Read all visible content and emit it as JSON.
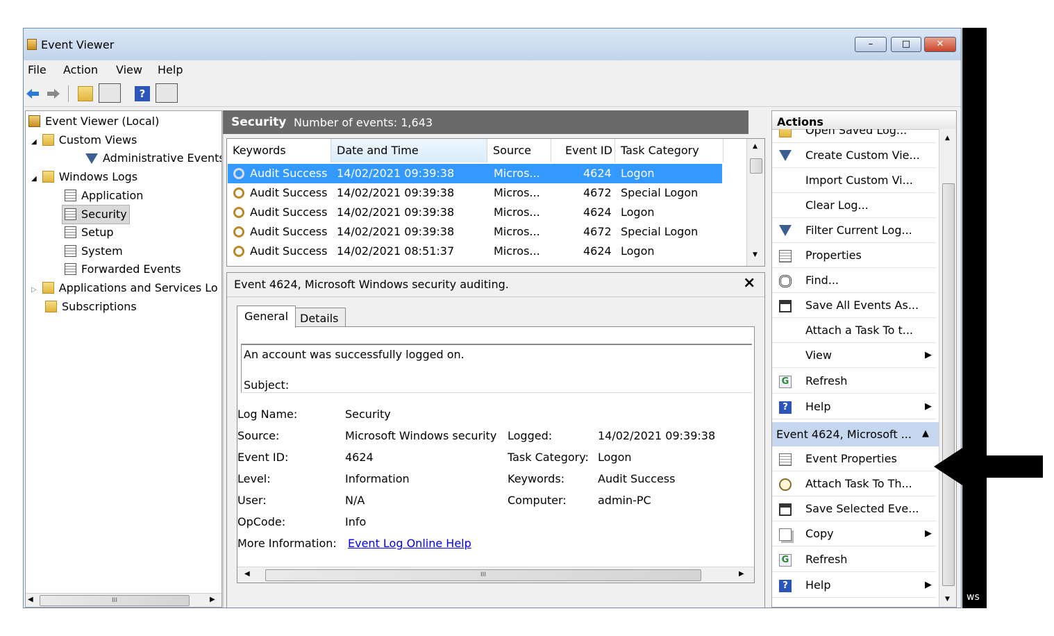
{
  "window": {
    "title": "Event Viewer",
    "min_label": "–",
    "max_label": "□",
    "close_label": "✕"
  },
  "menu": [
    "File",
    "Action",
    "View",
    "Help"
  ],
  "toolbar": {
    "icons": [
      "back-arrow-icon",
      "forward-arrow-icon",
      "folder-up-icon",
      "show-hide-tree-icon",
      "help-icon",
      "show-hide-action-pane-icon"
    ]
  },
  "tree": {
    "root": "Event Viewer (Local)",
    "custom_views": "Custom Views",
    "admin_events": "Administrative Events",
    "windows_logs": "Windows Logs",
    "application": "Application",
    "security": "Security",
    "setup": "Setup",
    "system": "System",
    "forwarded": "Forwarded Events",
    "apps_services": "Applications and Services Lo",
    "subscriptions": "Subscriptions",
    "hscroll_mark": "III"
  },
  "center": {
    "log_name": "Security",
    "event_count": "Number of events: 1,643"
  },
  "list": {
    "columns": [
      "Keywords",
      "Date and Time",
      "Source",
      "Event ID",
      "Task Category"
    ],
    "rows": [
      {
        "keywords": "Audit Success",
        "date": "14/02/2021 09:39:38",
        "source": "Micros...",
        "id": "4624",
        "task": "Logon"
      },
      {
        "keywords": "Audit Success",
        "date": "14/02/2021 09:39:38",
        "source": "Micros...",
        "id": "4672",
        "task": "Special Logon"
      },
      {
        "keywords": "Audit Success",
        "date": "14/02/2021 09:39:38",
        "source": "Micros...",
        "id": "4624",
        "task": "Logon"
      },
      {
        "keywords": "Audit Success",
        "date": "14/02/2021 09:39:38",
        "source": "Micros...",
        "id": "4672",
        "task": "Special Logon"
      },
      {
        "keywords": "Audit Success",
        "date": "14/02/2021 08:51:37",
        "source": "Micros...",
        "id": "4624",
        "task": "Logon"
      }
    ]
  },
  "detail": {
    "header": "Event 4624, Microsoft Windows security auditing.",
    "close": "×",
    "tab_general": "General",
    "tab_details": "Details",
    "message": "An account was successfully logged on.",
    "subject": "Subject:",
    "labels": {
      "log_name": "Log Name:",
      "source": "Source:",
      "event_id": "Event ID:",
      "level": "Level:",
      "user": "User:",
      "opcode": "OpCode:",
      "more_info": "More Information:",
      "logged": "Logged:",
      "task_category": "Task Category:",
      "keywords": "Keywords:",
      "computer": "Computer:"
    },
    "values": {
      "log_name": "Security",
      "source": "Microsoft Windows security",
      "event_id": "4624",
      "level": "Information",
      "user": "N/A",
      "opcode": "Info",
      "more_info": "Event Log Online Help",
      "logged": "14/02/2021 09:39:38",
      "task_category": "Logon",
      "keywords": "Audit Success",
      "computer": "admin-PC"
    },
    "hscroll_mark": "III"
  },
  "actions": {
    "header": "Actions",
    "log_items": [
      {
        "label": "Open Saved Log...",
        "icon": "open-folder-icon"
      },
      {
        "label": "Create Custom Vie...",
        "icon": "filter-icon"
      },
      {
        "label": "Import Custom Vi...",
        "icon": ""
      },
      {
        "label": "Clear Log...",
        "icon": ""
      },
      {
        "label": "Filter Current Log...",
        "icon": "filter-icon"
      },
      {
        "label": "Properties",
        "icon": "properties-icon"
      },
      {
        "label": "Find...",
        "icon": "binoculars-icon"
      },
      {
        "label": "Save All Events As...",
        "icon": "save-icon"
      },
      {
        "label": "Attach a Task To t...",
        "icon": ""
      },
      {
        "label": "View",
        "icon": "",
        "submenu": "▶"
      },
      {
        "label": "Refresh",
        "icon": "refresh-icon"
      },
      {
        "label": "Help",
        "icon": "help-icon",
        "submenu": "▶"
      }
    ],
    "event_section": "Event 4624, Microsoft ...",
    "event_section_toggle": "▲",
    "event_items": [
      {
        "label": "Event Properties",
        "icon": "properties-icon"
      },
      {
        "label": "Attach Task To Th...",
        "icon": "task-clock-icon"
      },
      {
        "label": "Save Selected Eve...",
        "icon": "save-icon"
      },
      {
        "label": "Copy",
        "icon": "copy-icon",
        "submenu": "▶"
      },
      {
        "label": "Refresh",
        "icon": "refresh-icon"
      },
      {
        "label": "Help",
        "icon": "help-icon",
        "submenu": "▶"
      }
    ]
  },
  "behind_text": "ws",
  "colors": {
    "accent_selection": "#3399ff",
    "header_gray": "#6a6a6a",
    "section_blue": "#c5d7ef",
    "link": "#0000ee"
  }
}
